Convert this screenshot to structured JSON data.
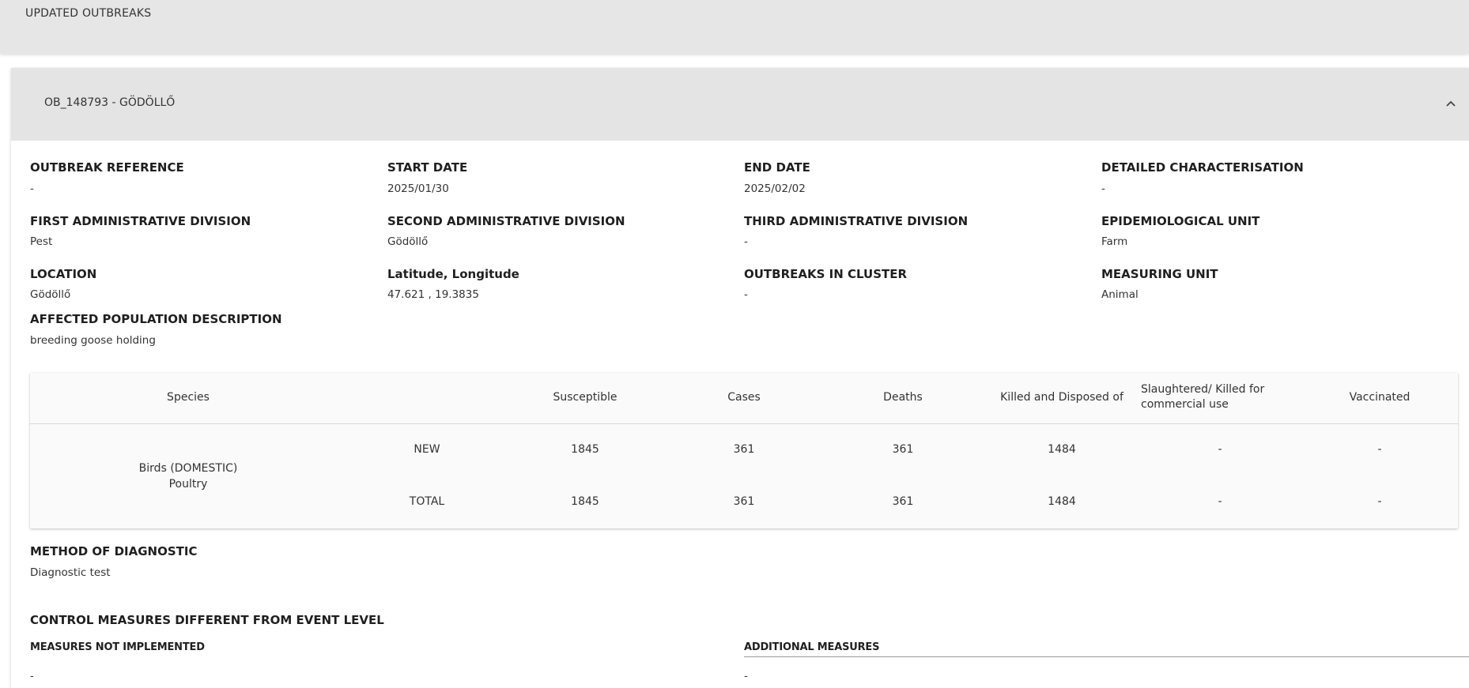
{
  "page": {
    "section_title": "UPDATED OUTBREAKS"
  },
  "outbreak": {
    "header_title": "OB_148793 - GÖDÖLLŐ",
    "fields": {
      "outbreak_reference": {
        "label": "OUTBREAK REFERENCE",
        "value": "-"
      },
      "start_date": {
        "label": "START DATE",
        "value": "2025/01/30"
      },
      "end_date": {
        "label": "END DATE",
        "value": "2025/02/02"
      },
      "detailed_characterisation": {
        "label": "DETAILED CHARACTERISATION",
        "value": "-"
      },
      "first_admin_division": {
        "label": "FIRST ADMINISTRATIVE DIVISION",
        "value": "Pest"
      },
      "second_admin_division": {
        "label": "SECOND ADMINISTRATIVE DIVISION",
        "value": "Gödöllő"
      },
      "third_admin_division": {
        "label": "THIRD ADMINISTRATIVE DIVISION",
        "value": "-"
      },
      "epidemiological_unit": {
        "label": "EPIDEMIOLOGICAL UNIT",
        "value": "Farm"
      },
      "location": {
        "label": "LOCATION",
        "value": "Gödöllő"
      },
      "lat_long": {
        "label": "Latitude, Longitude",
        "value": "47.621 , 19.3835"
      },
      "outbreaks_in_cluster": {
        "label": "OUTBREAKS IN CLUSTER",
        "value": "-"
      },
      "measuring_unit": {
        "label": "MEASURING UNIT",
        "value": "Animal"
      },
      "affected_population": {
        "label": "AFFECTED POPULATION DESCRIPTION",
        "value": "breeding goose holding"
      }
    },
    "table": {
      "headers": {
        "species": "Species",
        "susceptible": "Susceptible",
        "cases": "Cases",
        "deaths": "Deaths",
        "killed_disposed": "Killed and Disposed of",
        "slaughtered": "Slaughtered/ Killed for commercial use",
        "vaccinated": "Vaccinated"
      },
      "species_name": "Birds (DOMESTIC)",
      "species_group": "Poultry",
      "rows": [
        {
          "type": "NEW",
          "susceptible": "1845",
          "cases": "361",
          "deaths": "361",
          "killed_disposed": "1484",
          "slaughtered": "-",
          "vaccinated": "-"
        },
        {
          "type": "TOTAL",
          "susceptible": "1845",
          "cases": "361",
          "deaths": "361",
          "killed_disposed": "1484",
          "slaughtered": "-",
          "vaccinated": "-"
        }
      ]
    },
    "method_of_diagnostic": {
      "label": "METHOD OF DIAGNOSTIC",
      "value": "Diagnostic test"
    },
    "control_measures": {
      "title": "CONTROL MEASURES DIFFERENT FROM EVENT LEVEL",
      "not_implemented": {
        "label": "MEASURES NOT IMPLEMENTED",
        "value": "-"
      },
      "additional": {
        "label": "ADDITIONAL MEASURES",
        "value": "-"
      }
    }
  }
}
